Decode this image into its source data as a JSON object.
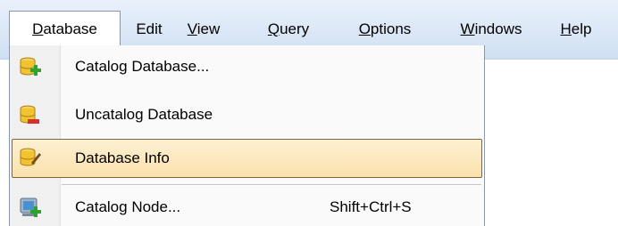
{
  "menubar": {
    "items": [
      {
        "mnemonic": "D",
        "rest": "atabase"
      },
      {
        "mnemonic": "",
        "rest": "Edit"
      },
      {
        "mnemonic": "V",
        "rest": "iew"
      },
      {
        "mnemonic": "Q",
        "rest": "uery"
      },
      {
        "mnemonic": "O",
        "rest": "ptions"
      },
      {
        "mnemonic": "W",
        "rest": "indows"
      },
      {
        "mnemonic": "H",
        "rest": "elp"
      }
    ]
  },
  "dropdown": {
    "items": [
      {
        "label": "Catalog Database...",
        "icon": "database-add-icon",
        "shortcut": ""
      },
      {
        "label": "Uncatalog Database",
        "icon": "database-remove-icon",
        "shortcut": ""
      },
      {
        "label": "Database Info",
        "icon": "database-edit-icon",
        "shortcut": ""
      },
      {
        "label": "Catalog Node...",
        "icon": "node-add-icon",
        "shortcut": "Shift+Ctrl+S"
      }
    ]
  },
  "colors": {
    "menubar_bg": "#dbe7f6",
    "highlight_bg": "#fbe1ad",
    "highlight_border": "#7a6a3a",
    "db_icon_yellow": "#f2c230",
    "add_green": "#2fa12f",
    "remove_red": "#d53030"
  }
}
